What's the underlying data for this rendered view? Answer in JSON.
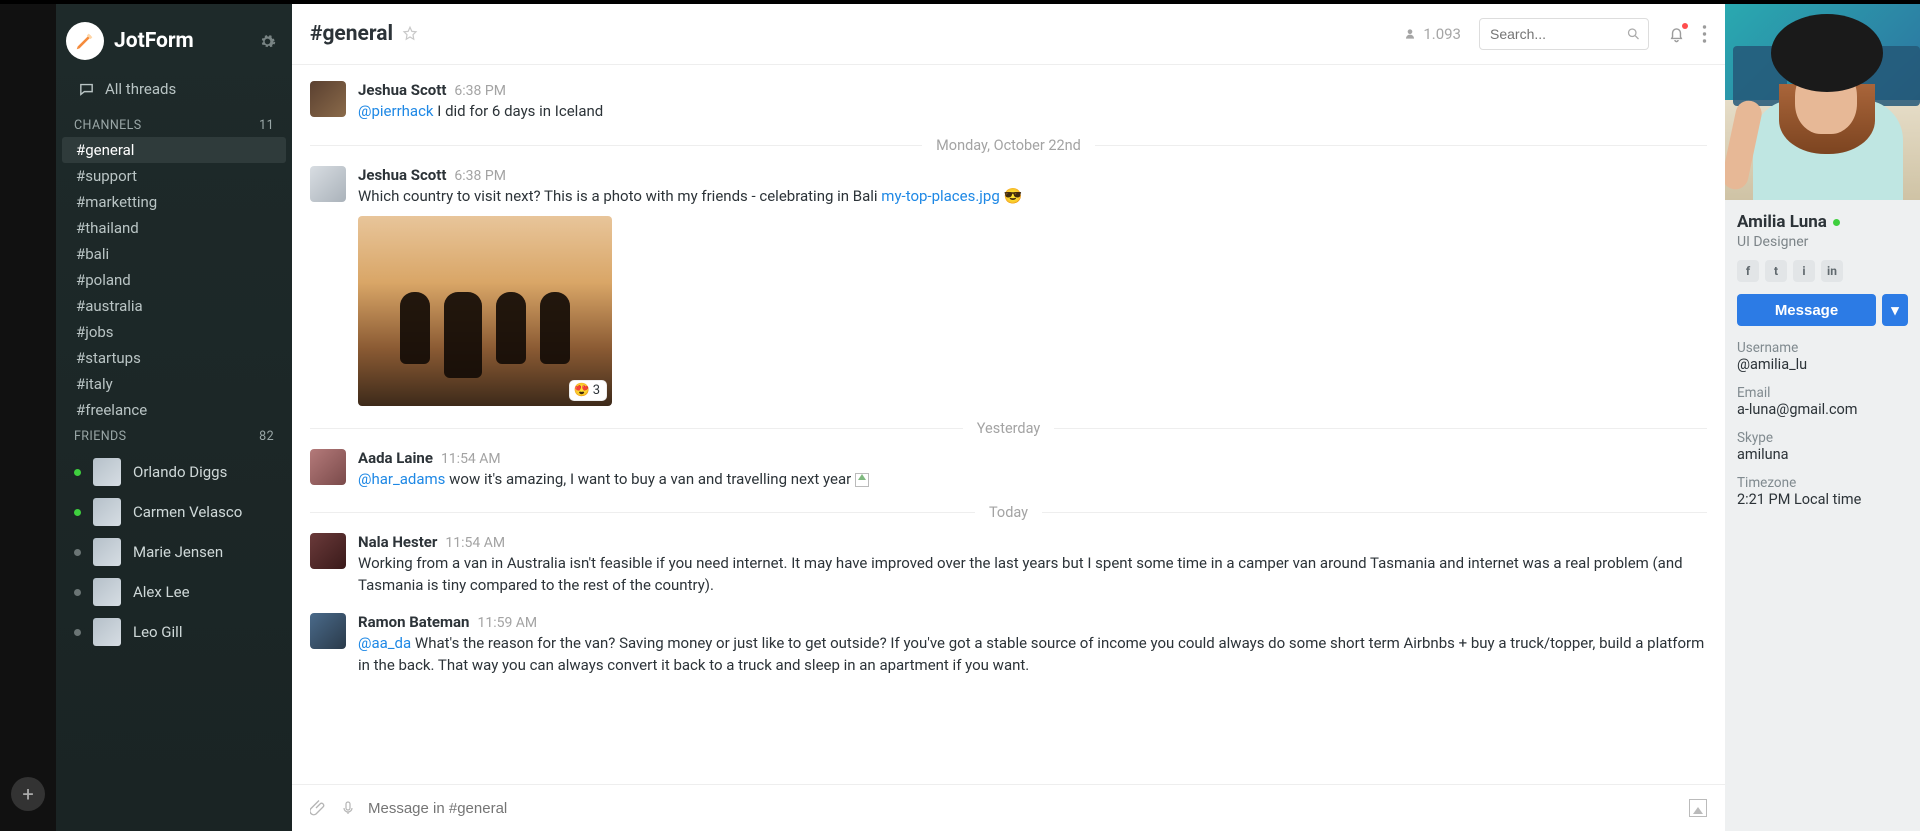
{
  "workspace": {
    "name": "JotForm"
  },
  "threads_label": "All threads",
  "channels_header": {
    "label": "CHANNELS",
    "count": "11"
  },
  "channels": [
    {
      "name": "#general",
      "active": true
    },
    {
      "name": "#support"
    },
    {
      "name": "#marketting"
    },
    {
      "name": "#thailand"
    },
    {
      "name": "#bali"
    },
    {
      "name": "#poland"
    },
    {
      "name": "#australia"
    },
    {
      "name": "#jobs"
    },
    {
      "name": "#startups"
    },
    {
      "name": "#italy"
    },
    {
      "name": "#freelance"
    }
  ],
  "friends_header": {
    "label": "FRIENDS",
    "count": "82"
  },
  "friends": [
    {
      "name": "Orlando Diggs",
      "online": true
    },
    {
      "name": "Carmen Velasco",
      "online": true
    },
    {
      "name": "Marie Jensen",
      "online": false
    },
    {
      "name": "Alex Lee",
      "online": false
    },
    {
      "name": "Leo Gill",
      "online": false
    }
  ],
  "header": {
    "channel": "#general",
    "member_count": "1.093",
    "search_placeholder": "Search..."
  },
  "dividers": {
    "d0": "Monday, October 22nd",
    "d1": "Yesterday",
    "d2": "Today"
  },
  "messages": {
    "m0": {
      "author": "Jeshua Scott",
      "time": "6:38 PM",
      "mention": "@pierrhack",
      "text": " I did for 6 days in Iceland"
    },
    "m1": {
      "author": "Jeshua Scott",
      "time": "6:38 PM",
      "text": "Which country to visit next? This is a photo with my friends - celebrating in Bali ",
      "attachment": "my-top-places.jpg",
      "emoji": "😎",
      "reaction_emoji": "😍",
      "reaction_count": "3"
    },
    "m2": {
      "author": "Aada Laine",
      "time": "11:54 AM",
      "mention": "@har_adams",
      "text": " wow it's amazing, I want to buy a van and travelling next year "
    },
    "m3": {
      "author": "Nala Hester",
      "time": "11:54 AM",
      "text": "Working from a van in Australia isn't feasible if you need internet. It may have improved over the last years but I spent some time in a camper van around Tasmania and internet was a real problem (and Tasmania is tiny compared to the rest of the country)."
    },
    "m4": {
      "author": "Ramon Bateman",
      "time": "11:59 AM",
      "mention": "@aa_da",
      "text": " What's the reason for the van? Saving money or just like to get outside? If you've got a stable source of income you could always do some short term Airbnbs + buy a truck/topper, build a platform in the back. That way you can always convert it back to a truck and sleep in an apartment if you want."
    }
  },
  "composer": {
    "placeholder": "Message in #general"
  },
  "profile": {
    "name": "Amilia Luna",
    "role": "UI Designer",
    "button": "Message",
    "fields": {
      "username": {
        "label": "Username",
        "value": "@amilia_lu"
      },
      "email": {
        "label": "Email",
        "value": "a-luna@gmail.com"
      },
      "skype": {
        "label": "Skype",
        "value": "amiluna"
      },
      "timezone": {
        "label": "Timezone",
        "value": "2:21 PM Local time"
      }
    }
  },
  "icons": {
    "f": "f",
    "t": "t",
    "i": "i",
    "in": "in",
    "caret": "▾",
    "plus": "+"
  }
}
